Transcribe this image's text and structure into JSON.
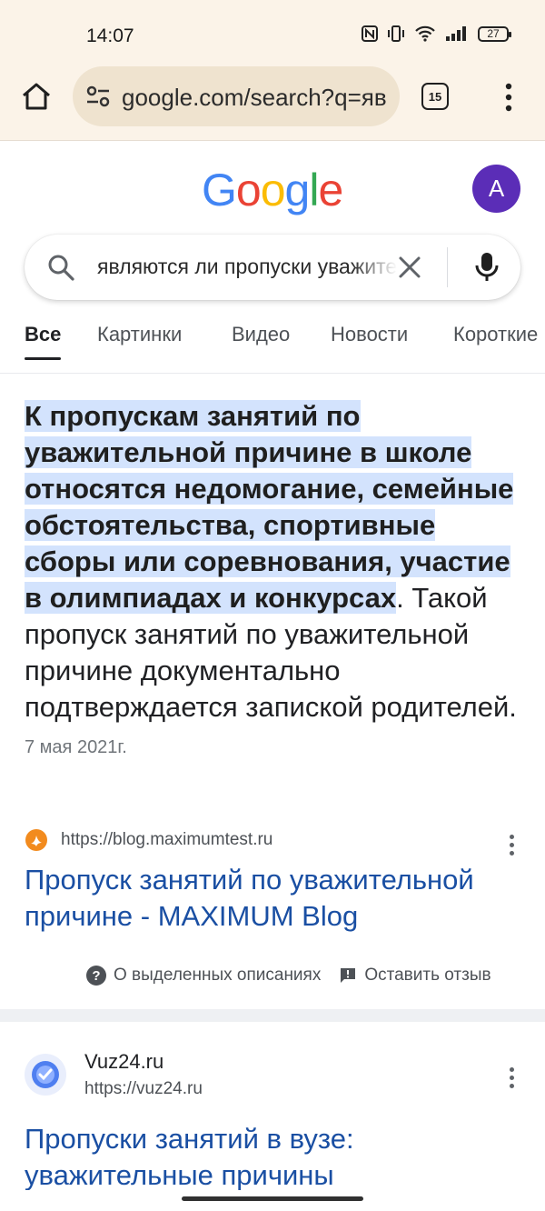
{
  "status_bar": {
    "time": "14:07",
    "battery": "27"
  },
  "browser": {
    "url": "google.com/search?q=яв",
    "tab_count": "15"
  },
  "google": {
    "logo": {
      "letters": [
        "G",
        "o",
        "o",
        "g",
        "l",
        "e"
      ],
      "colors": [
        "#4285F4",
        "#EA4335",
        "#FBBC05",
        "#4285F4",
        "#34A853",
        "#EA4335"
      ]
    },
    "avatar_letter": "A",
    "avatar_color": "#5b2db7",
    "query": "являются ли пропуски уважительными"
  },
  "filters": [
    {
      "label": "Все",
      "active": true
    },
    {
      "label": "Картинки"
    },
    {
      "label": "Видео"
    },
    {
      "label": "Новости"
    },
    {
      "label": "Короткие"
    }
  ],
  "featured_snippet": {
    "highlighted": " К пропускам занятий по уважительной причине в школе относятся недомогание, семейные обстоятельства, спортивные сборы или соревнования, участие в олимпиадах и конкурсах",
    "rest": ". Такой пропуск занятий по уважительной причине документально подтверждается запиской родителей.",
    "date": "7 мая 2021г.",
    "source_url": "https://blog.maximumtest.ru",
    "title": "Пропуск занятий по уважительной причине - MAXIMUM Blog",
    "about_label": "О выделенных описаниях",
    "feedback_label": "Оставить отзыв"
  },
  "result2": {
    "site": "Vuz24.ru",
    "url": "https://vuz24.ru",
    "title": "Пропуски занятий в вузе: уважительные причины"
  },
  "colors": {
    "link": "#1a4fa3",
    "highlight": "#d3e3fd",
    "chrome_bg": "#fbf3e8"
  }
}
